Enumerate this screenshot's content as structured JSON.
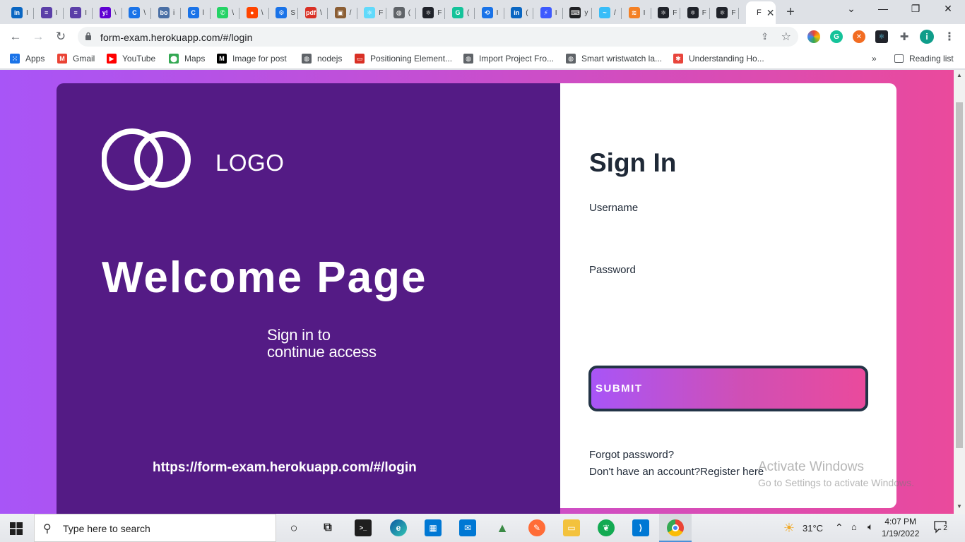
{
  "browser": {
    "tabs": [
      {
        "icon": "linkedin-icon",
        "color": "#0a66c2",
        "glyph": "in",
        "label": "I"
      },
      {
        "icon": "list-icon",
        "color": "#5b3fa8",
        "glyph": "≡",
        "label": "I"
      },
      {
        "icon": "list-icon",
        "color": "#5b3fa8",
        "glyph": "≡",
        "label": "I"
      },
      {
        "icon": "yahoo-icon",
        "color": "#6001d2",
        "glyph": "y!",
        "label": "\\"
      },
      {
        "icon": "c-icon",
        "color": "#1a73e8",
        "glyph": "C",
        "label": "\\"
      },
      {
        "icon": "bo-icon",
        "color": "#4a6fa5",
        "glyph": "bo",
        "label": "i"
      },
      {
        "icon": "c-icon",
        "color": "#1a73e8",
        "glyph": "C",
        "label": "l"
      },
      {
        "icon": "whatsapp-icon",
        "color": "#25d366",
        "glyph": "✆",
        "label": "\\"
      },
      {
        "icon": "reddit-icon",
        "color": "#ff4500",
        "glyph": "●",
        "label": "\\"
      },
      {
        "icon": "gear-icon",
        "color": "#1a73e8",
        "glyph": "⚙",
        "label": "S"
      },
      {
        "icon": "pdf-icon",
        "color": "#d93025",
        "glyph": "pdf",
        "label": "\\"
      },
      {
        "icon": "devtools-icon",
        "color": "#8b5e34",
        "glyph": "▣",
        "label": "/"
      },
      {
        "icon": "react-icon",
        "color": "#61dafb",
        "glyph": "⚛",
        "label": "F"
      },
      {
        "icon": "globe-icon",
        "color": "#5f6368",
        "glyph": "◍",
        "label": "("
      },
      {
        "icon": "react-dark-icon",
        "color": "#20232a",
        "glyph": "⚛",
        "label": "F"
      },
      {
        "icon": "grammarly-icon",
        "color": "#15c39a",
        "glyph": "G",
        "label": "("
      },
      {
        "icon": "history-icon",
        "color": "#1a73e8",
        "glyph": "⟲",
        "label": "I"
      },
      {
        "icon": "linkedin-icon",
        "color": "#0a66c2",
        "glyph": "in",
        "label": "("
      },
      {
        "icon": "bolt-icon",
        "color": "#3d5afe",
        "glyph": "⚡",
        "label": "I"
      },
      {
        "icon": "keyboard-icon",
        "color": "#202124",
        "glyph": "⌨",
        "label": "y"
      },
      {
        "icon": "tailwind-icon",
        "color": "#38bdf8",
        "glyph": "~",
        "label": "/"
      },
      {
        "icon": "stackoverflow-icon",
        "color": "#f48024",
        "glyph": "≋",
        "label": "I"
      },
      {
        "icon": "react-dark-icon",
        "color": "#20232a",
        "glyph": "⚛",
        "label": "F"
      },
      {
        "icon": "react-dark-icon",
        "color": "#20232a",
        "glyph": "⚛",
        "label": "F"
      },
      {
        "icon": "react-dark-icon",
        "color": "#20232a",
        "glyph": "⚛",
        "label": "F"
      }
    ],
    "active_tab": {
      "label": "F",
      "close": "✕"
    },
    "new_tab": "+",
    "url": "form-exam.herokuapp.com/#/login",
    "bookmarks": [
      {
        "icon": "apps-grid-icon",
        "label": "Apps",
        "color": "#1a73e8"
      },
      {
        "icon": "gmail-icon",
        "label": "Gmail",
        "color": "#ea4335"
      },
      {
        "icon": "youtube-icon",
        "label": "YouTube",
        "color": "#ff0000"
      },
      {
        "icon": "maps-pin-icon",
        "label": "Maps",
        "color": "#34a853"
      },
      {
        "icon": "medium-icon",
        "label": "Image for post",
        "color": "#000000"
      },
      {
        "icon": "globe-icon",
        "label": "nodejs",
        "color": "#5f6368"
      },
      {
        "icon": "w3-icon",
        "label": "Positioning Element...",
        "color": "#d93025"
      },
      {
        "icon": "globe-icon",
        "label": "Import Project Fro...",
        "color": "#5f6368"
      },
      {
        "icon": "globe-icon",
        "label": "Smart wristwatch la...",
        "color": "#5f6368"
      },
      {
        "icon": "asterisk-icon",
        "label": "Understanding Ho...",
        "color": "#e8453c"
      }
    ],
    "more_bookmarks": "»",
    "reading_list": "Reading list",
    "profile_initial": "i"
  },
  "page": {
    "logo_text": "LOGO",
    "welcome_title": "Welcome Page",
    "subtitle_line1": "Sign in to",
    "subtitle_line2": "continue access",
    "page_url": "https://form-exam.herokuapp.com/#/login",
    "signin_title": "Sign In",
    "username_label": "Username",
    "password_label": "Password",
    "submit_label": "SUBMIT",
    "forgot_password": "Forgot password?",
    "no_account": "Don't have an account?Register here",
    "colors": {
      "panel_purple": "#541b85",
      "gradient_start": "#a855f7",
      "gradient_end": "#ea4a9c",
      "submit_border": "#233447"
    }
  },
  "watermark": {
    "line1": "Activate Windows",
    "line2": "Go to Settings to activate Windows."
  },
  "taskbar": {
    "search_placeholder": "Type here to search",
    "temperature": "31°C",
    "time": "4:07 PM",
    "date": "1/19/2022",
    "notifications": "2"
  }
}
